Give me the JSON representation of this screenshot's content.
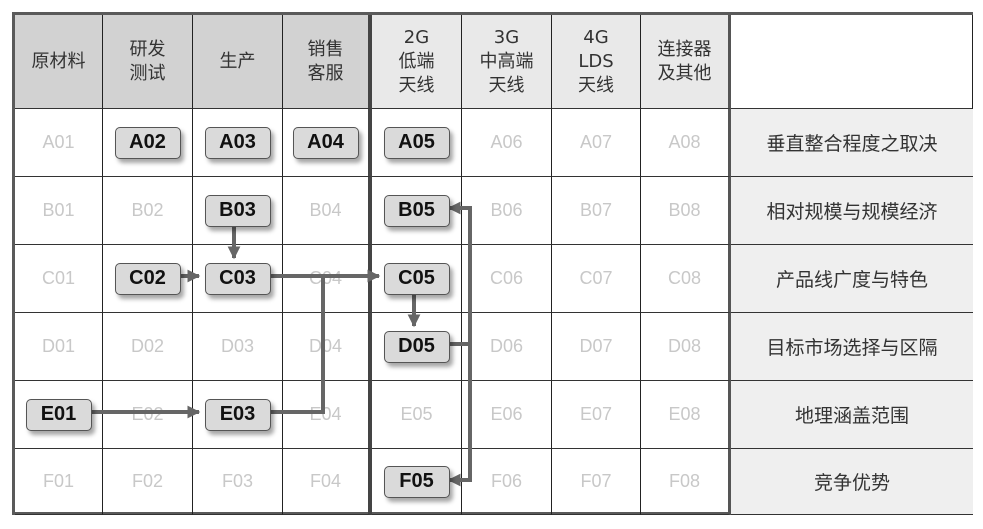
{
  "headers": [
    {
      "text": "原材料",
      "tone": "dark"
    },
    {
      "text": "研发\n测试",
      "tone": "dark"
    },
    {
      "text": "生产",
      "tone": "dark"
    },
    {
      "text": "销售\n客服",
      "tone": "dark"
    },
    {
      "text": "2G\n低端\n天线",
      "tone": "light"
    },
    {
      "text": "3G\n中高端\n天线",
      "tone": "light"
    },
    {
      "text": "4G\nLDS\n天线",
      "tone": "light"
    },
    {
      "text": "连接器\n及其他",
      "tone": "light"
    },
    {
      "text": "",
      "tone": "blank"
    }
  ],
  "rows": [
    {
      "label": "垂直整合程度之取决",
      "cells": [
        "A01",
        "A02",
        "A03",
        "A04",
        "A05",
        "A06",
        "A07",
        "A08"
      ],
      "highlighted": [
        "A02",
        "A03",
        "A04",
        "A05"
      ]
    },
    {
      "label": "相对规模与规模经济",
      "cells": [
        "B01",
        "B02",
        "B03",
        "B04",
        "B05",
        "B06",
        "B07",
        "B08"
      ],
      "highlighted": [
        "B03",
        "B05"
      ]
    },
    {
      "label": "产品线广度与特色",
      "cells": [
        "C01",
        "C02",
        "C03",
        "C04",
        "C05",
        "C06",
        "C07",
        "C08"
      ],
      "highlighted": [
        "C02",
        "C03",
        "C05"
      ]
    },
    {
      "label": "目标市场选择与区隔",
      "cells": [
        "D01",
        "D02",
        "D03",
        "D04",
        "D05",
        "D06",
        "D07",
        "D08"
      ],
      "highlighted": [
        "D05"
      ]
    },
    {
      "label": "地理涵盖范围",
      "cells": [
        "E01",
        "E02",
        "E03",
        "E04",
        "E05",
        "E06",
        "E07",
        "E08"
      ],
      "highlighted": [
        "E01",
        "E03"
      ]
    },
    {
      "label": "竞争优势",
      "cells": [
        "F01",
        "F02",
        "F03",
        "F04",
        "F05",
        "F06",
        "F07",
        "F08"
      ],
      "highlighted": [
        "F05"
      ]
    }
  ],
  "connections": [
    [
      "B03",
      "C03"
    ],
    [
      "C02",
      "C03"
    ],
    [
      "C03",
      "C05"
    ],
    [
      "E01",
      "E03"
    ],
    [
      "E03",
      "C05"
    ],
    [
      "C05",
      "D05"
    ],
    [
      "D05",
      "B05"
    ],
    [
      "D05",
      "F05"
    ]
  ],
  "colors": {
    "arrow": "#666666",
    "chip": "#dadada",
    "header_dark": "#d2d2d2",
    "header_light": "#e9e9e9",
    "label_bg": "#efefef",
    "faded_code": "#c8c8c8"
  }
}
